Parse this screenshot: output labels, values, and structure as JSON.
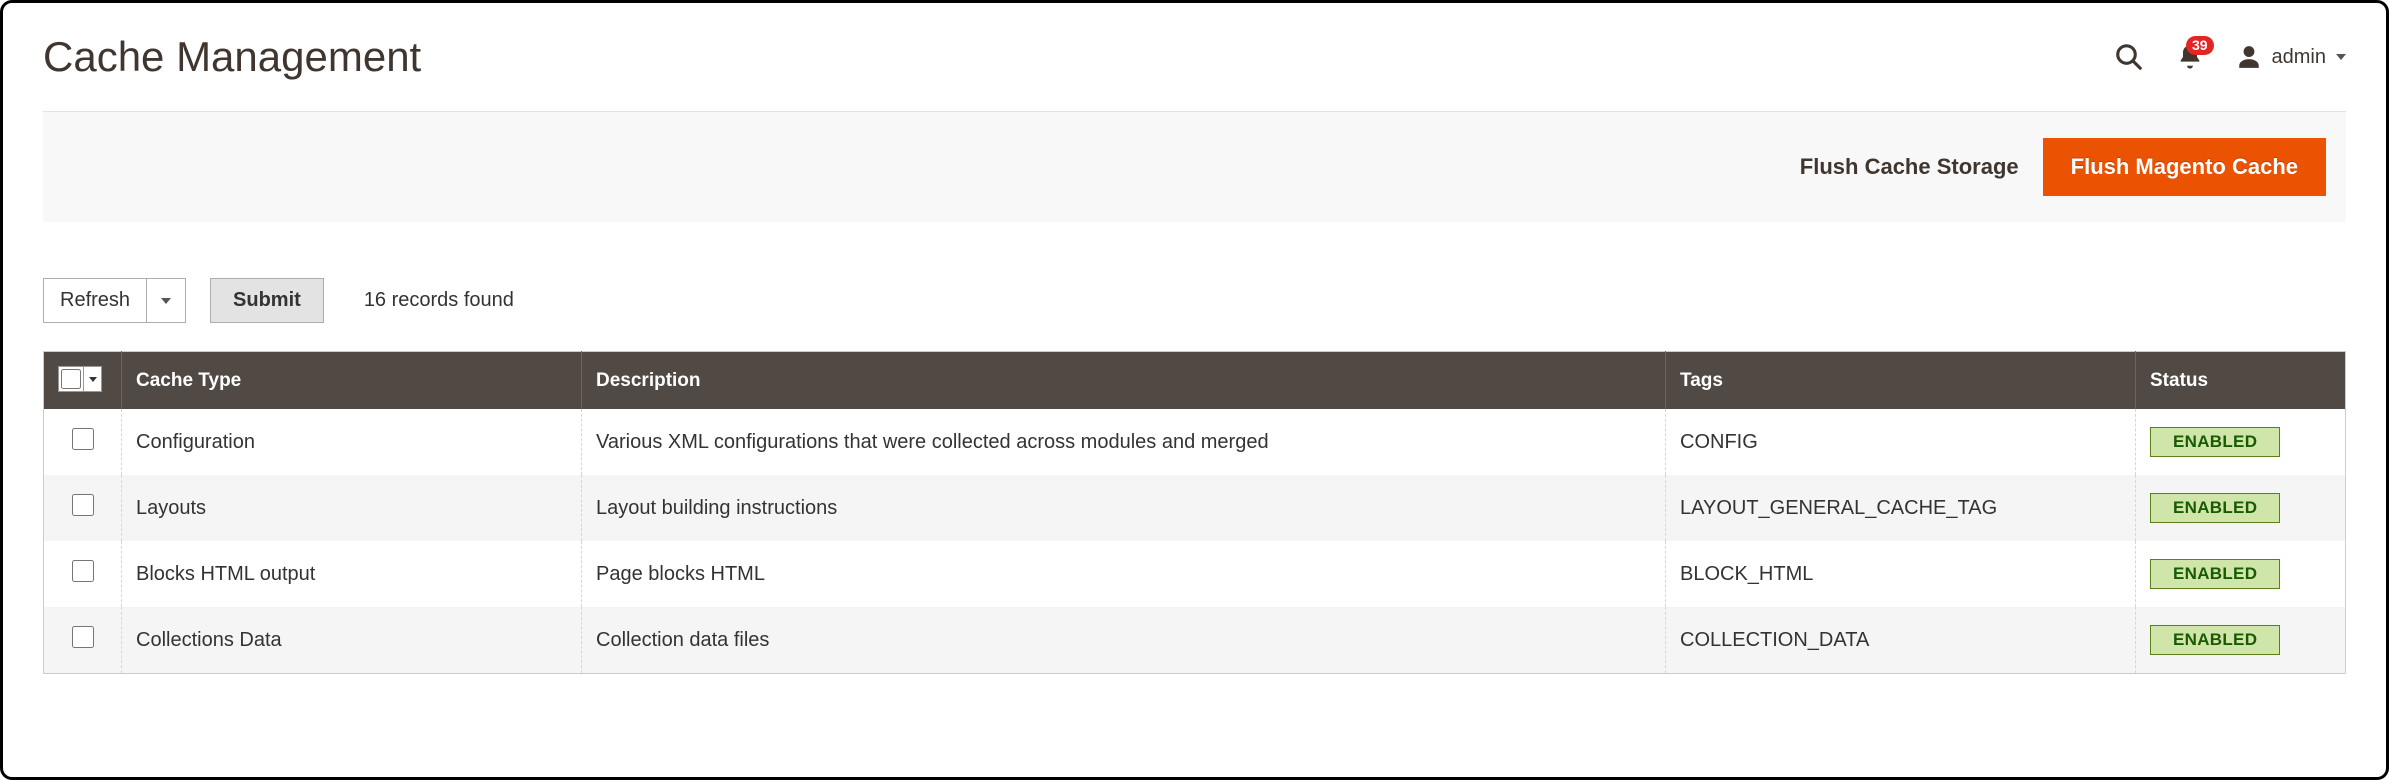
{
  "header": {
    "title": "Cache Management",
    "notification_count": "39",
    "user_label": "admin"
  },
  "action_bar": {
    "flush_storage_label": "Flush Cache Storage",
    "flush_magento_label": "Flush Magento Cache"
  },
  "toolbar": {
    "mass_action_label": "Refresh",
    "submit_label": "Submit",
    "records_found": "16 records found"
  },
  "table": {
    "headers": {
      "cache_type": "Cache Type",
      "description": "Description",
      "tags": "Tags",
      "status": "Status"
    },
    "rows": [
      {
        "type": "Configuration",
        "description": "Various XML configurations that were collected across modules and merged",
        "tags": "CONFIG",
        "status": "ENABLED"
      },
      {
        "type": "Layouts",
        "description": "Layout building instructions",
        "tags": "LAYOUT_GENERAL_CACHE_TAG",
        "status": "ENABLED"
      },
      {
        "type": "Blocks HTML output",
        "description": "Page blocks HTML",
        "tags": "BLOCK_HTML",
        "status": "ENABLED"
      },
      {
        "type": "Collections Data",
        "description": "Collection data files",
        "tags": "COLLECTION_DATA",
        "status": "ENABLED"
      }
    ]
  }
}
